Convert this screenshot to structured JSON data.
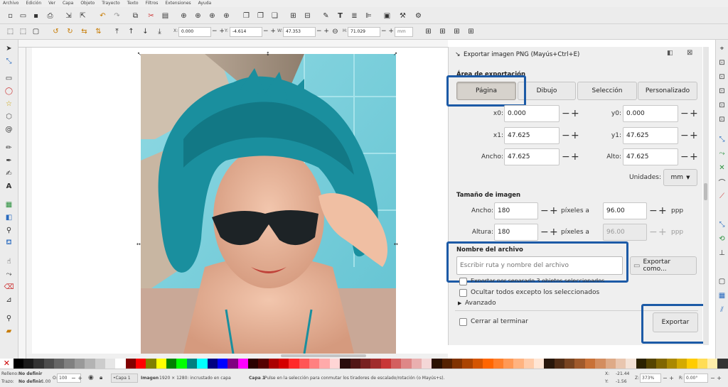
{
  "menu": [
    "Archivo",
    "Edición",
    "Ver",
    "Capa",
    "Objeto",
    "Trayecto",
    "Texto",
    "Filtros",
    "Extensiones",
    "Ayuda"
  ],
  "toolbar": {
    "x_label": "X:",
    "x_value": "0.000",
    "y_label": "Y:",
    "y_value": "-4.614",
    "w_label": "W:",
    "w_value": "47.353",
    "h_label": "H:",
    "h_value": "71.029",
    "unit": "mm"
  },
  "dialog": {
    "title": "Exportar imagen PNG (Mayús+Ctrl+E)",
    "area_heading": "Área de exportación",
    "area_tabs": [
      "Página",
      "Dibujo",
      "Selección",
      "Personalizado"
    ],
    "x0_label": "x0:",
    "x0_value": "0.000",
    "y0_label": "y0:",
    "y0_value": "0.000",
    "x1_label": "x1:",
    "x1_value": "47.625",
    "y1_label": "y1:",
    "y1_value": "47.625",
    "ancho_label": "Ancho:",
    "ancho_value": "47.625",
    "alto_label": "Alto:",
    "alto_value": "47.625",
    "units_label": "Unidades:",
    "units_value": "mm",
    "size_heading": "Tamaño de imagen",
    "img_width_label": "Ancho:",
    "img_width_value": "180",
    "img_height_label": "Altura:",
    "img_height_value": "180",
    "px_at_1": "píxeles a",
    "px_at_2": "píxeles a",
    "dpi_value_1": "96.00",
    "dpi_value_2": "96.00",
    "dpi_unit_1": "ppp",
    "dpi_unit_2": "ppp",
    "filename_heading": "Nombre del archivo",
    "filename_placeholder": "Escribir ruta y nombre del archivo",
    "export_as_label": "Exportar como...",
    "batch_label": "Exportar por separado 3 objetos seleccionados",
    "hide_label": "Ocultar todos excepto los seleccionados",
    "advanced_label": "Avanzado",
    "close_when_done_label": "Cerrar al terminar",
    "export_label": "Exportar"
  },
  "status": {
    "fill_label": "Relleno:",
    "fill_value": "No definir",
    "stroke_label": "Trazo:",
    "stroke_value": "No definir",
    "stroke_width": "1.00",
    "opacity_label": "O:",
    "opacity_value": "100",
    "layer": "•Capa 1",
    "message_bold": "Imagen",
    "message": " 1920 × 1280: incrustado en capa ",
    "message_layer": "Capa 1",
    "message_tail": ". Pulse en la selección para conmutar los tiradores de escalado/rotación (o Mayús+s).",
    "x_label": "X:",
    "x_value": "-21.44",
    "y_label": "Y:",
    "y_value": "-1.56",
    "z_label": "Z:",
    "z_value": "373%",
    "r_label": "R:",
    "r_value": "0.00°"
  },
  "colors": {
    "accent": "#1c5aa6",
    "hair": "#1a8f9e",
    "pool": "#7ed0dc"
  }
}
